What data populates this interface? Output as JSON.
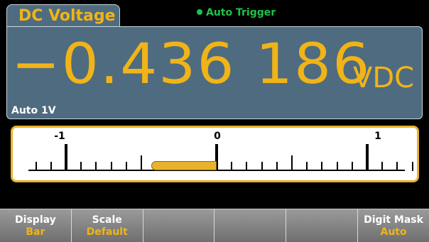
{
  "tab": {
    "label": "DC Voltage"
  },
  "trigger": {
    "label": "Auto Trigger"
  },
  "reading": {
    "value": "−0.436 186",
    "unit": "VDC"
  },
  "range": {
    "label": "Auto 1V"
  },
  "bar": {
    "scale_labels": [
      "-1",
      "0",
      "1"
    ],
    "scale_min": -1.25,
    "scale_max": 1.25,
    "value": -0.436186,
    "color": "#e8b32a"
  },
  "softkeys": [
    {
      "top": "Display",
      "bottom": "Bar"
    },
    {
      "top": "Scale",
      "bottom": "Default"
    },
    {
      "top": "",
      "bottom": ""
    },
    {
      "top": "",
      "bottom": ""
    },
    {
      "top": "",
      "bottom": ""
    },
    {
      "top": "Digit Mask",
      "bottom": "Auto"
    }
  ],
  "colors": {
    "accent": "#f0b418",
    "panel": "#4f6b80",
    "trigger": "#1ec24a"
  }
}
